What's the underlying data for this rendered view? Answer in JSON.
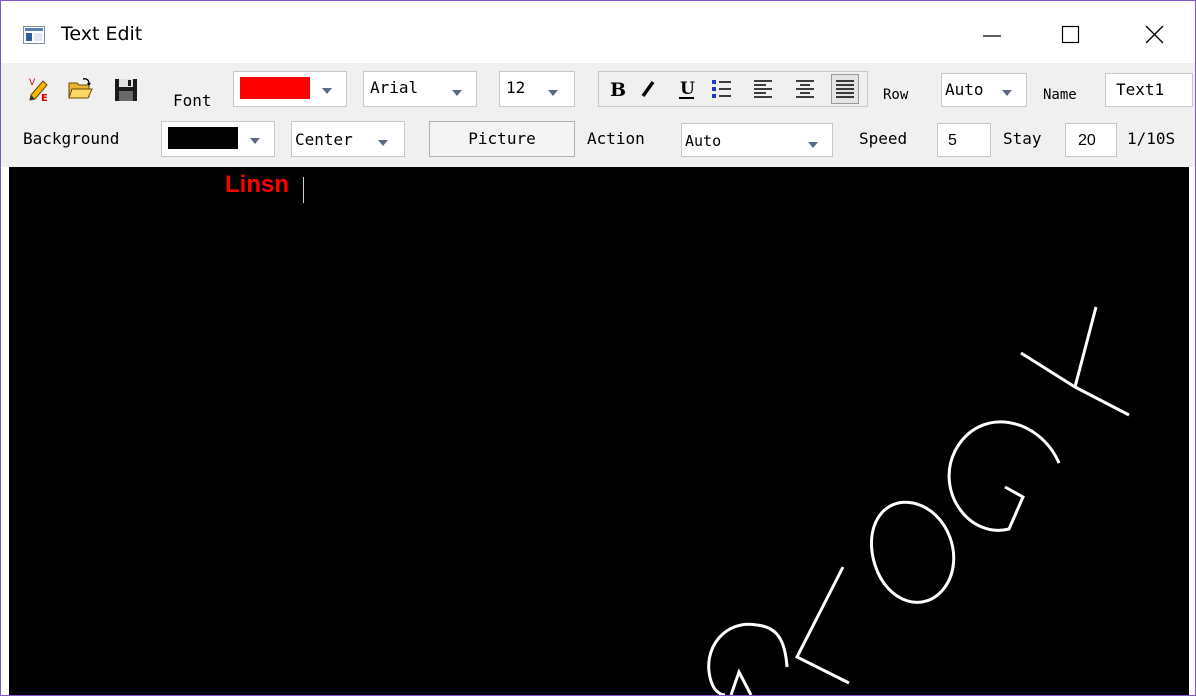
{
  "window": {
    "title": "Text Edit",
    "border_color": "#7e57c2"
  },
  "toolbar": {
    "font_label": "Font",
    "font_color": "#ff0000",
    "font_family": "Arial",
    "font_size": "12",
    "format_buttons": [
      "bold",
      "italic",
      "underline",
      "bullet-list",
      "align-left",
      "align-center",
      "align-right"
    ],
    "row_label": "Row",
    "row_value": "Auto",
    "name_label": "Name",
    "name_value": "Text1",
    "background_label": "Background",
    "background_color": "#000000",
    "align_value": "Center",
    "picture_label": "Picture",
    "action_label": "Action",
    "action_value": "Auto",
    "speed_label": "Speed",
    "speed_value": "5",
    "stay_label": "Stay",
    "stay_value": "20",
    "stay_unit": "1/10S"
  },
  "canvas": {
    "text": "Linsn",
    "text_color": "#ff0000",
    "background": "#000000",
    "watermark_color": "#ffffff"
  }
}
